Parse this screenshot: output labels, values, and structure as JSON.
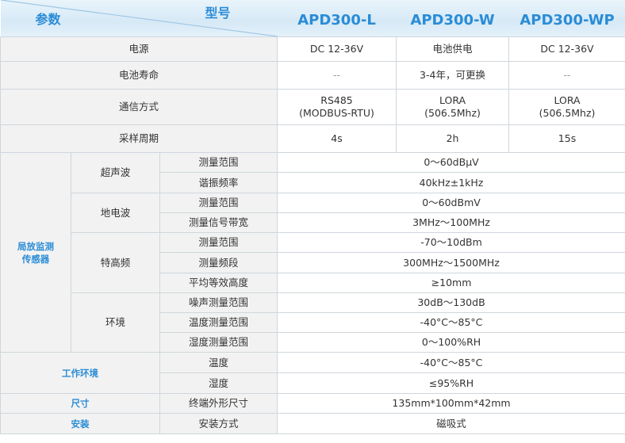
{
  "header": {
    "param_label": "参数",
    "model_label": "型号",
    "models": [
      "APD300-L",
      "APD300-W",
      "APD300-WP"
    ]
  },
  "basic": [
    {
      "name": "电源",
      "values": [
        "DC 12-36V",
        "电池供电",
        "DC 12-36V"
      ]
    },
    {
      "name": "电池寿命",
      "values": [
        "--",
        "3-4年，可更换",
        "--"
      ]
    },
    {
      "name": "通信方式",
      "values": [
        [
          "RS485",
          "(MODBUS-RTU)"
        ],
        [
          "LORA",
          "(506.5Mhz)"
        ],
        [
          "LORA",
          "(506.5Mhz)"
        ]
      ]
    },
    {
      "name": "采样周期",
      "values": [
        "4s",
        "2h",
        "15s"
      ]
    }
  ],
  "sensor": {
    "label_line1": "局放监测",
    "label_line2": "传感器",
    "groups": [
      {
        "name": "超声波",
        "rows": [
          {
            "param": "测量范围",
            "value": "0～60dBμV"
          },
          {
            "param": "谐振频率",
            "value": "40kHz±1kHz"
          }
        ]
      },
      {
        "name": "地电波",
        "rows": [
          {
            "param": "测量范围",
            "value": "0～60dBmV"
          },
          {
            "param": "测量信号带宽",
            "value": "3MHz～100MHz"
          }
        ]
      },
      {
        "name": "特高频",
        "rows": [
          {
            "param": "测量范围",
            "value": "-70～10dBm"
          },
          {
            "param": "测量频段",
            "value": "300MHz～1500MHz"
          },
          {
            "param": "平均等效高度",
            "value": "≥10mm"
          }
        ]
      },
      {
        "name": "环境",
        "rows": [
          {
            "param": "噪声测量范围",
            "value": "30dB～130dB"
          },
          {
            "param": "温度测量范围",
            "value": "-40°C～85°C"
          },
          {
            "param": "湿度测量范围",
            "value": "0～100%RH"
          }
        ]
      }
    ]
  },
  "env": {
    "label": "工作环境",
    "rows": [
      {
        "param": "温度",
        "value": "-40°C～85°C"
      },
      {
        "param": "湿度",
        "value": "≤95%RH"
      }
    ]
  },
  "size": {
    "label": "尺寸",
    "param": "终端外形尺寸",
    "value": "135mm*100mm*42mm"
  },
  "install": {
    "label": "安装",
    "param": "安装方式",
    "value": "磁吸式"
  }
}
